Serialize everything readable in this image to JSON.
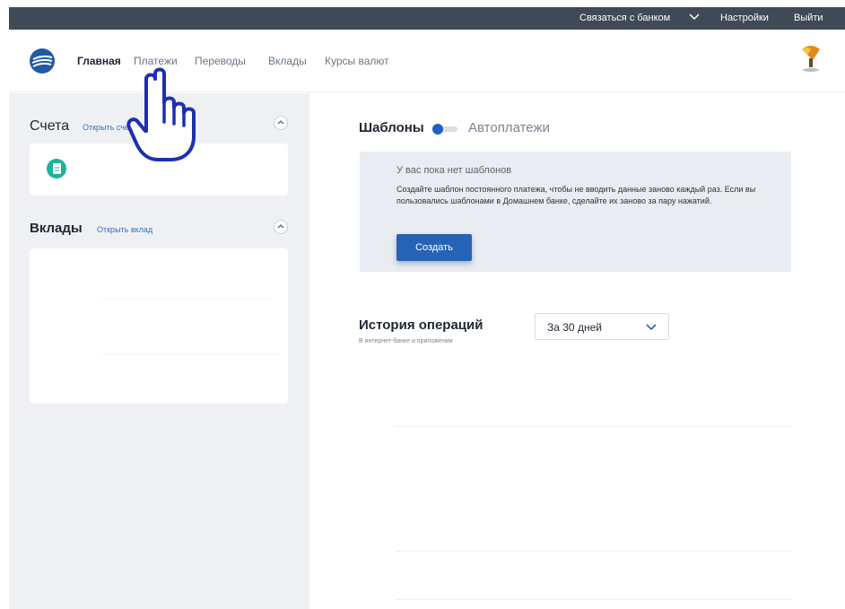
{
  "topbar": {
    "contact_label": "Связаться с банком",
    "settings_label": "Настройки",
    "logout_label": "Выйти",
    "chevron_icon": "chevron-down-icon"
  },
  "nav": {
    "items": [
      {
        "label": "Главная",
        "active": true
      },
      {
        "label": "Платежи",
        "active": false
      },
      {
        "label": "Переводы",
        "active": false
      },
      {
        "label": "Вклады",
        "active": false
      },
      {
        "label": "Курсы валют",
        "active": false
      }
    ]
  },
  "accounts": {
    "title": "Счета",
    "open_link": "Открыть сче"
  },
  "deposits": {
    "title": "Вклады",
    "open_link": "Открыть вклад"
  },
  "templates": {
    "tab_templates": "Шаблоны",
    "tab_autopay": "Автоплатежи",
    "empty_title": "У вас пока нет шаблонов",
    "empty_text": "Создайте шаблон постоянного платежа, чтобы не вводить данные заново каждый раз. Если вы пользовались шаблонами в Домашнем банке, сделайте их заново за пару нажатий.",
    "create_button": "Создать"
  },
  "history": {
    "title": "История операций",
    "subtitle": "В интернет-банке и приложении",
    "period_value": "За 30 дней"
  },
  "colors": {
    "topbar": "#3f4a56",
    "accent": "#2663b4",
    "account_icon": "#19b59a",
    "hand": "#1d2fb0"
  },
  "icons": [
    "bank-logo-icon",
    "chevron-down-icon",
    "chevron-up-icon",
    "document-icon",
    "avatar-icon",
    "pointing-hand-icon"
  ]
}
